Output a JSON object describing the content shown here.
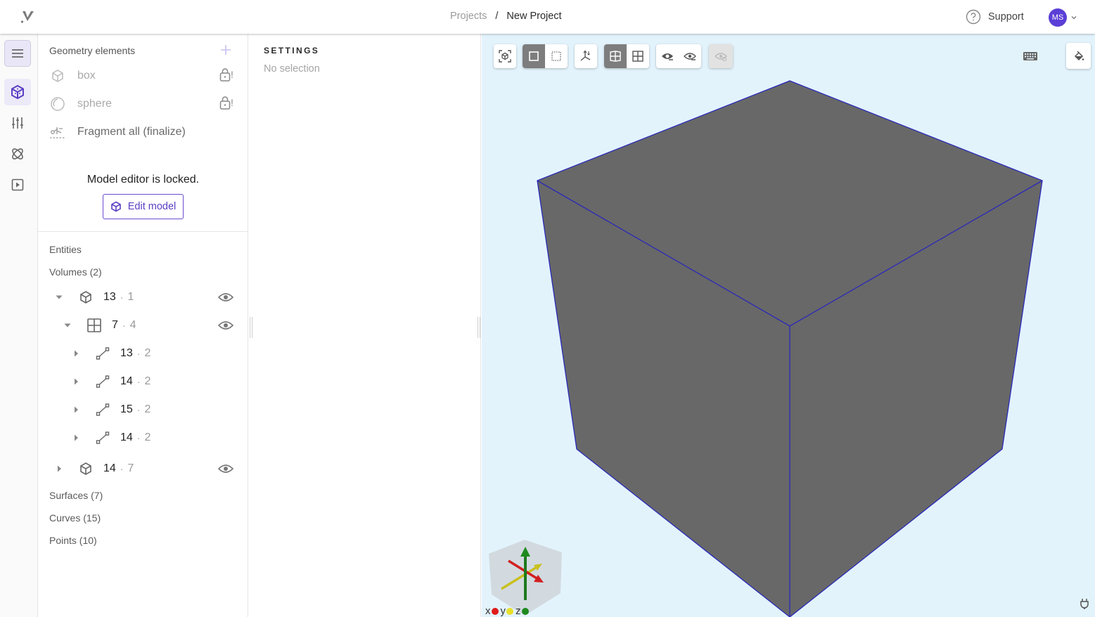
{
  "header": {
    "logo": "app-logo",
    "breadcrumb": {
      "parent": "Projects",
      "separator": "/",
      "current": "New Project"
    },
    "support_label": "Support",
    "user_initials": "MS",
    "colors": {
      "avatar": "#5b3fd6",
      "accent": "#5b3fc4"
    }
  },
  "rail": {
    "items": [
      {
        "icon": "menu-icon",
        "label": "Menu"
      },
      {
        "icon": "geometry-cube-icon",
        "label": "Geometry",
        "active": true
      },
      {
        "icon": "sliders-icon",
        "label": "Mesh settings"
      },
      {
        "icon": "atom-icon",
        "label": "Physics"
      },
      {
        "icon": "play-icon",
        "label": "Run"
      }
    ]
  },
  "geometry": {
    "title": "Geometry elements",
    "add_icon": "plus-icon",
    "items": [
      {
        "icon": "cube-icon",
        "label": "box",
        "locked": true,
        "lock_suffix": "!"
      },
      {
        "icon": "sphere-icon",
        "label": "sphere",
        "locked": true,
        "lock_suffix": "!"
      },
      {
        "icon": "fragment-icon",
        "label": "Fragment all (finalize)",
        "locked": false
      }
    ],
    "locked_message": "Model editor is locked.",
    "edit_button": "Edit model"
  },
  "entities": {
    "title": "Entities",
    "volumes_label": "Volumes (2)",
    "tree": [
      {
        "level": 0,
        "expanded": true,
        "icon": "cube-icon",
        "id": "13",
        "count": "1",
        "eye": true
      },
      {
        "level": 1,
        "expanded": true,
        "icon": "surface-grid-icon",
        "id": "7",
        "count": "4",
        "eye": true
      },
      {
        "level": 2,
        "expanded": false,
        "icon": "curve-icon",
        "id": "13",
        "count": "2",
        "eye": false
      },
      {
        "level": 2,
        "expanded": false,
        "icon": "curve-icon",
        "id": "14",
        "count": "2",
        "eye": false
      },
      {
        "level": 2,
        "expanded": false,
        "icon": "curve-icon",
        "id": "15",
        "count": "2",
        "eye": false
      },
      {
        "level": 2,
        "expanded": false,
        "icon": "curve-icon",
        "id": "14",
        "count": "2",
        "eye": false
      },
      {
        "level": 0,
        "expanded": false,
        "icon": "cube-icon",
        "id": "14",
        "count": "7",
        "eye": true
      }
    ],
    "dot": "·",
    "surfaces_label": "Surfaces (7)",
    "curves_label": "Curves (15)",
    "points_label": "Points (10)"
  },
  "settings": {
    "title": "SETTINGS",
    "empty_text": "No selection"
  },
  "viewport": {
    "background": "#e3f3fc",
    "toolbar": [
      {
        "name": "fit-view",
        "icon": "focus-cube-icon",
        "state": "normal"
      },
      {
        "name": "select-solid",
        "icon": "square-icon",
        "state": "on"
      },
      {
        "name": "select-box",
        "icon": "dashed-square-icon",
        "state": "normal"
      },
      {
        "name": "axes",
        "icon": "axes-icon",
        "state": "normal"
      },
      {
        "name": "view-shaded",
        "icon": "shaded-grid-icon",
        "state": "on"
      },
      {
        "name": "view-wireframe",
        "icon": "grid-icon",
        "state": "normal"
      },
      {
        "name": "hide-selected",
        "icon": "eye-minus-filled-icon",
        "state": "normal"
      },
      {
        "name": "hide-others",
        "icon": "eye-minus-icon",
        "state": "normal"
      },
      {
        "name": "show-all",
        "icon": "eye-refresh-icon",
        "state": "disabled"
      }
    ],
    "keyboard_icon": "keyboard-icon",
    "paint_icon": "paint-bucket-icon",
    "model_color": "#686868",
    "edge_color": "#2a2ab8",
    "axis_legend": [
      {
        "label": "x",
        "color": "#e01b1b"
      },
      {
        "label": "y",
        "color": "#e8e02a"
      },
      {
        "label": "z",
        "color": "#1e8a1e"
      }
    ],
    "connection_icon": "plug-icon"
  }
}
